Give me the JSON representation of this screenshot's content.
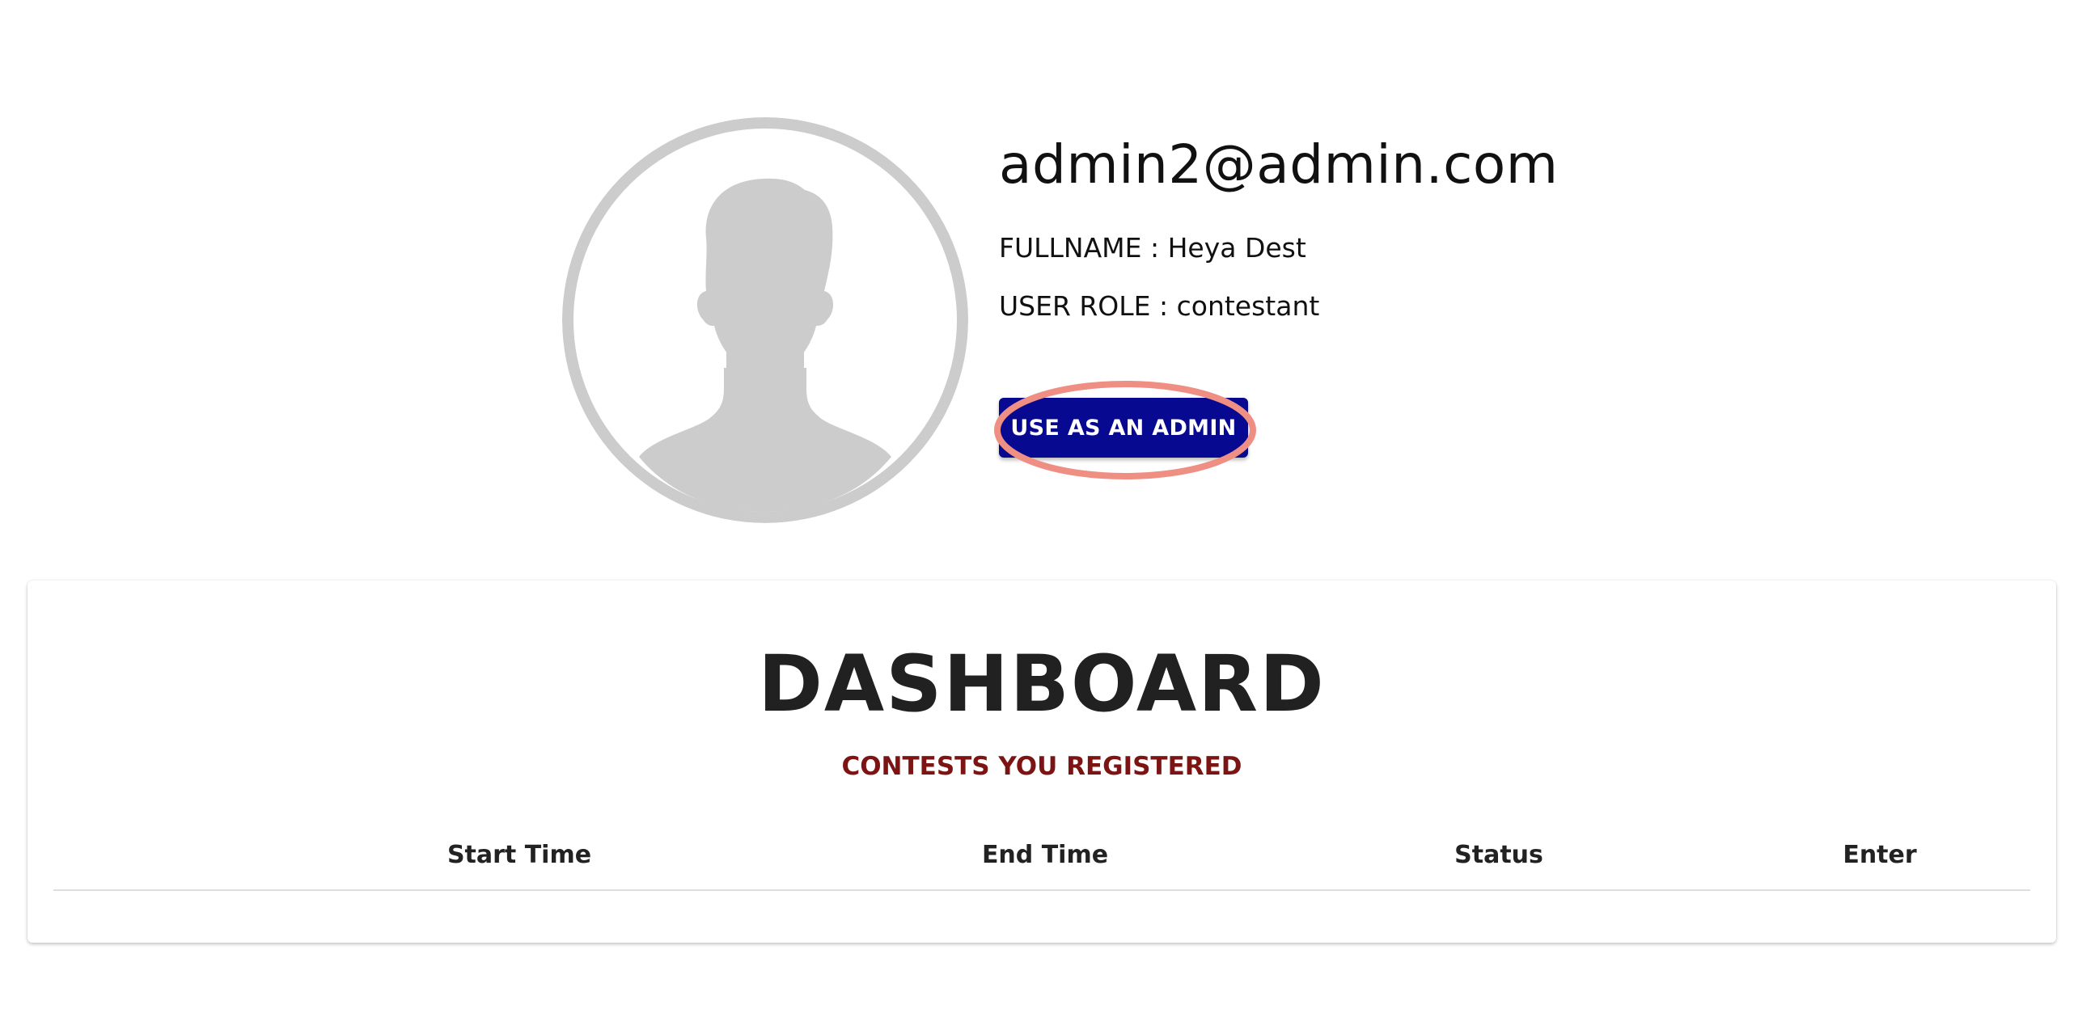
{
  "profile": {
    "email": "admin2@admin.com",
    "fullname_line": "FULLNAME : Heya Dest",
    "role_line": "USER ROLE : contestant",
    "admin_button_label": "USE AS AN ADMIN",
    "avatar_icon": "default-user-avatar-icon"
  },
  "dashboard": {
    "title": "DASHBOARD",
    "subtitle": "CONTESTS YOU REGISTERED",
    "columns": [
      "Start Time",
      "End Time",
      "Status",
      "Enter"
    ],
    "rows": []
  },
  "colors": {
    "admin_button": "#070991",
    "subtitle": "#7d1414",
    "avatar_gray": "#cccccc",
    "highlight_ring": "#ef8f84"
  }
}
